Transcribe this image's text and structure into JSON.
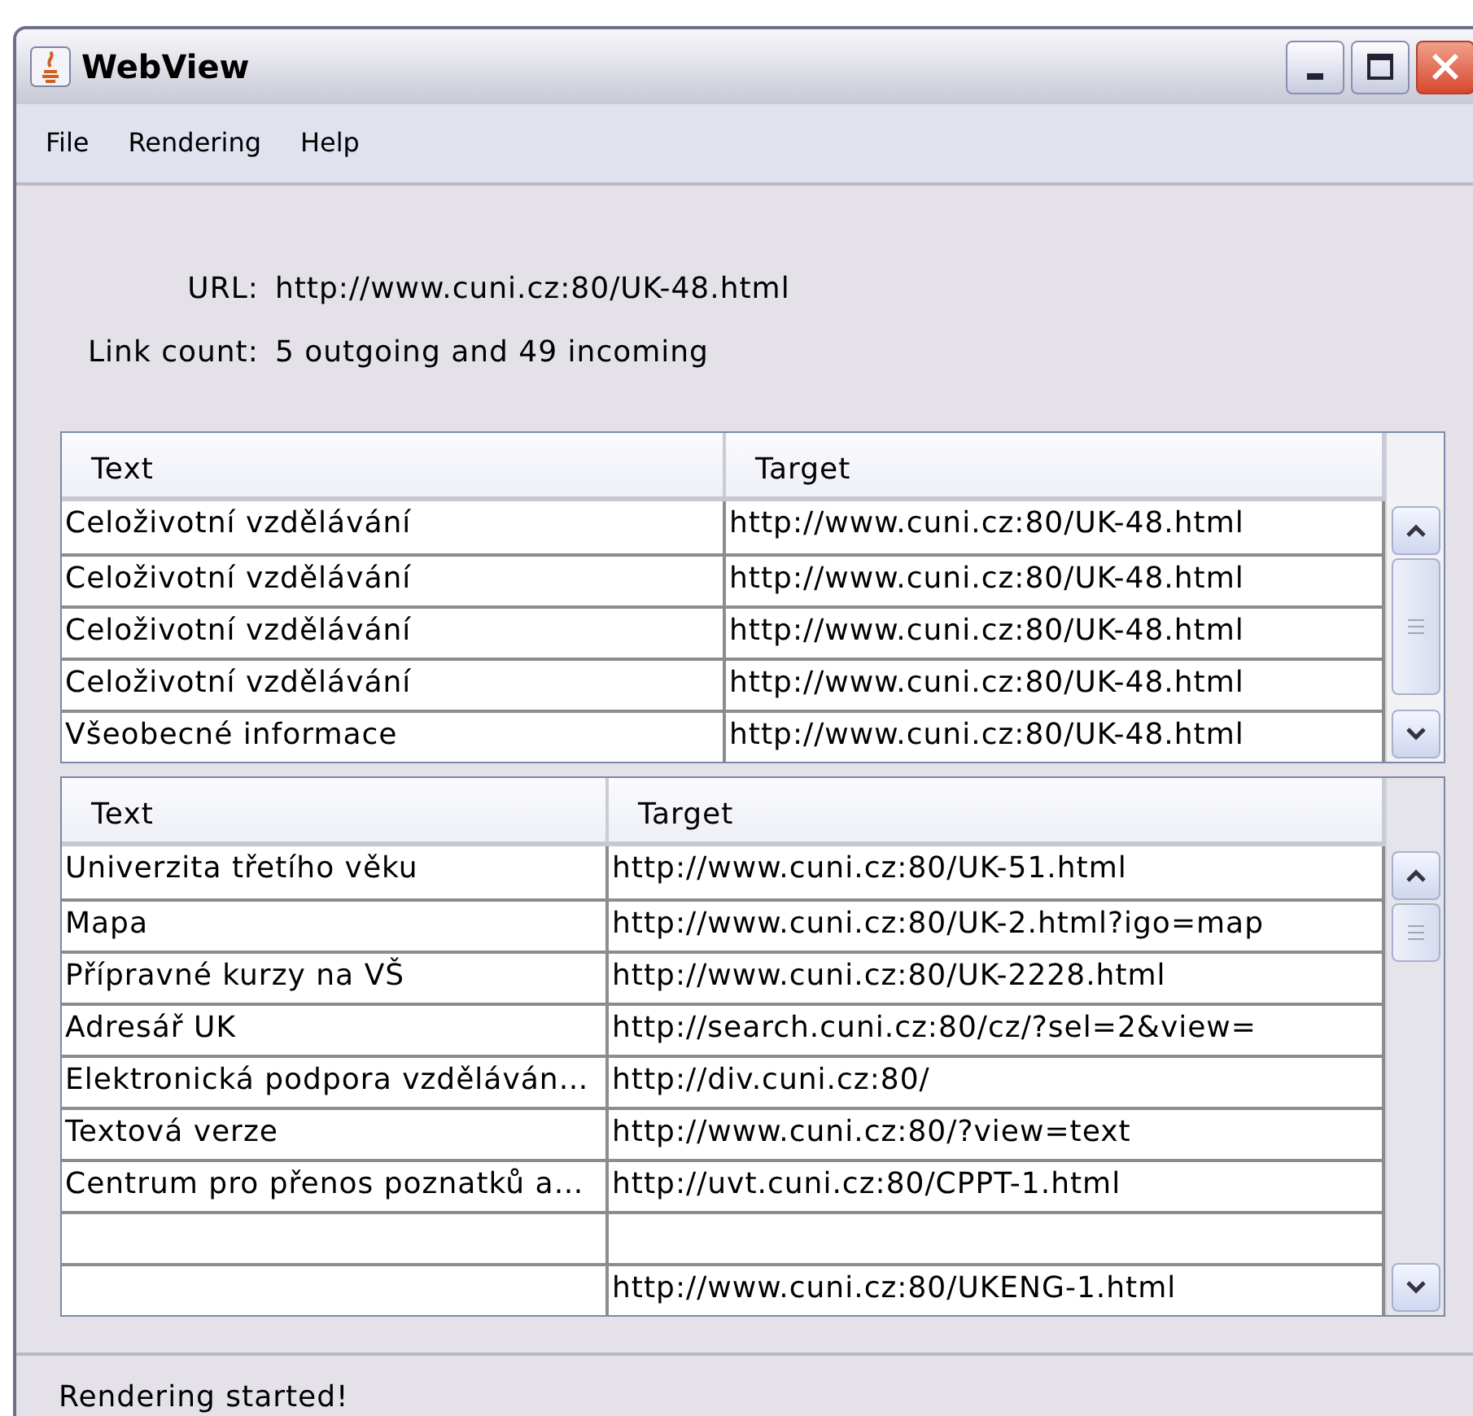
{
  "window": {
    "title": "WebView"
  },
  "menu": [
    "File",
    "Rendering",
    "Help"
  ],
  "info": [
    {
      "label": "URL:",
      "value": "http://www.cuni.cz:80/UK-48.html"
    },
    {
      "label": "Link count:",
      "value": "5 outgoing and 49 incoming"
    }
  ],
  "tables": [
    {
      "columns": [
        "Text",
        "Target"
      ],
      "rows": [
        [
          "Celoživotní vzdělávání",
          "http://www.cuni.cz:80/UK-48.html"
        ],
        [
          "Celoživotní vzdělávání",
          "http://www.cuni.cz:80/UK-48.html"
        ],
        [
          "Celoživotní vzdělávání",
          "http://www.cuni.cz:80/UK-48.html"
        ],
        [
          "Celoživotní vzdělávání",
          "http://www.cuni.cz:80/UK-48.html"
        ],
        [
          "Všeobecné informace",
          "http://www.cuni.cz:80/UK-48.html"
        ]
      ]
    },
    {
      "columns": [
        "Text",
        "Target"
      ],
      "rows": [
        [
          "Univerzita třetího věku",
          "http://www.cuni.cz:80/UK-51.html"
        ],
        [
          "Mapa",
          "http://www.cuni.cz:80/UK-2.html?igo=map"
        ],
        [
          "Přípravné kurzy na VŠ",
          "http://www.cuni.cz:80/UK-2228.html"
        ],
        [
          "Adresář UK",
          "http://search.cuni.cz:80/cz/?sel=2&view="
        ],
        [
          "Elektronická podpora vzděláván…",
          "http://div.cuni.cz:80/"
        ],
        [
          "Textová verze",
          "http://www.cuni.cz:80/?view=text"
        ],
        [
          "Centrum pro přenos poznatků a…",
          "http://uvt.cuni.cz:80/CPPT-1.html"
        ],
        [
          "",
          ""
        ],
        [
          "",
          "http://www.cuni.cz:80/UKENG-1.html"
        ]
      ]
    }
  ],
  "status_bar": "Rendering started!"
}
